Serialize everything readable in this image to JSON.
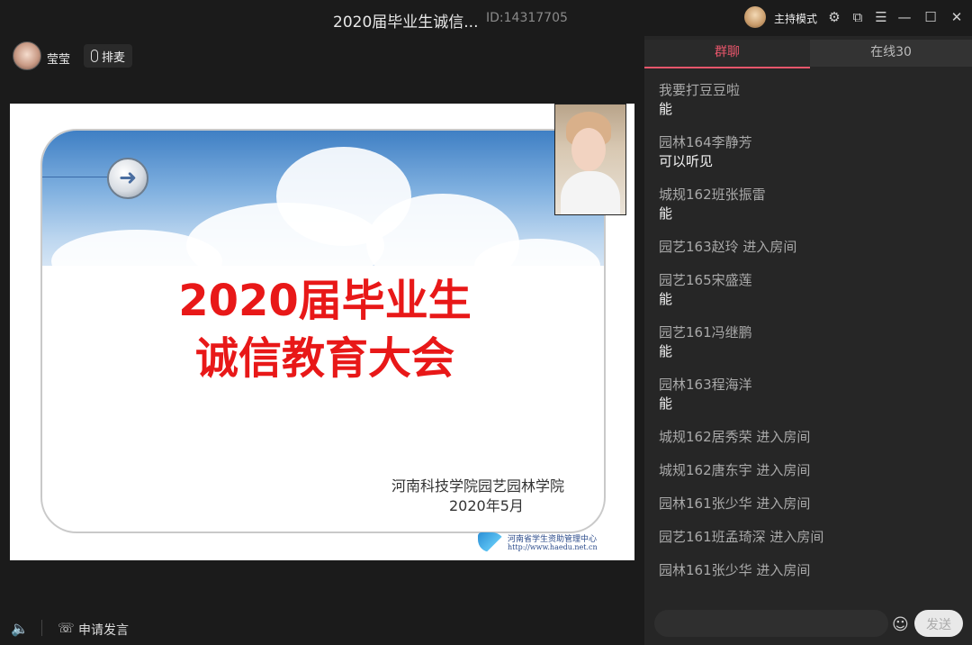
{
  "titlebar": {
    "title": "2020届毕业生诚信...",
    "room_id": "ID:14317705",
    "host_mode": "主持模式",
    "icons": [
      "settings-icon",
      "popout-icon",
      "menu-icon",
      "minimize-icon",
      "maximize-icon",
      "close-icon"
    ]
  },
  "toolbar": {
    "user_name": "莹莹",
    "mic_queue": "排麦"
  },
  "slide": {
    "line1": "2020届毕业生",
    "line2": "诚信教育大会",
    "org": "河南科技学院园艺园林学院",
    "date": "2020年5月",
    "logo_name": "河南省学生资助管理中心",
    "logo_url": "http://www.haedu.net.cn"
  },
  "bottom": {
    "apply_speak": "申请发言"
  },
  "chat": {
    "tab_group": "群聊",
    "tab_online": "在线30",
    "messages": [
      {
        "user": "我要打豆豆啦",
        "text": "能"
      },
      {
        "user": "园林164李静芳",
        "text": "可以听见"
      },
      {
        "user": "城规162班张振雷",
        "text": "能"
      },
      {
        "entry": "园艺163赵玲 进入房间"
      },
      {
        "user": "园艺165宋盛莲",
        "text": "能"
      },
      {
        "user": "园艺161冯继鹏",
        "text": "能"
      },
      {
        "user": "园林163程海洋",
        "text": "能"
      },
      {
        "entry": "城规162居秀荣 进入房间"
      },
      {
        "entry": "城规162唐东宇 进入房间"
      },
      {
        "entry": "园林161张少华 进入房间"
      },
      {
        "entry": "园艺161班孟琦深 进入房间"
      },
      {
        "entry": "园林161张少华 进入房间"
      }
    ],
    "input_placeholder": "",
    "send_label": "发送"
  },
  "colors": {
    "accent": "#e8566b",
    "slide_title": "#e81818",
    "background": "#1b1b1b",
    "panel": "#262626"
  }
}
